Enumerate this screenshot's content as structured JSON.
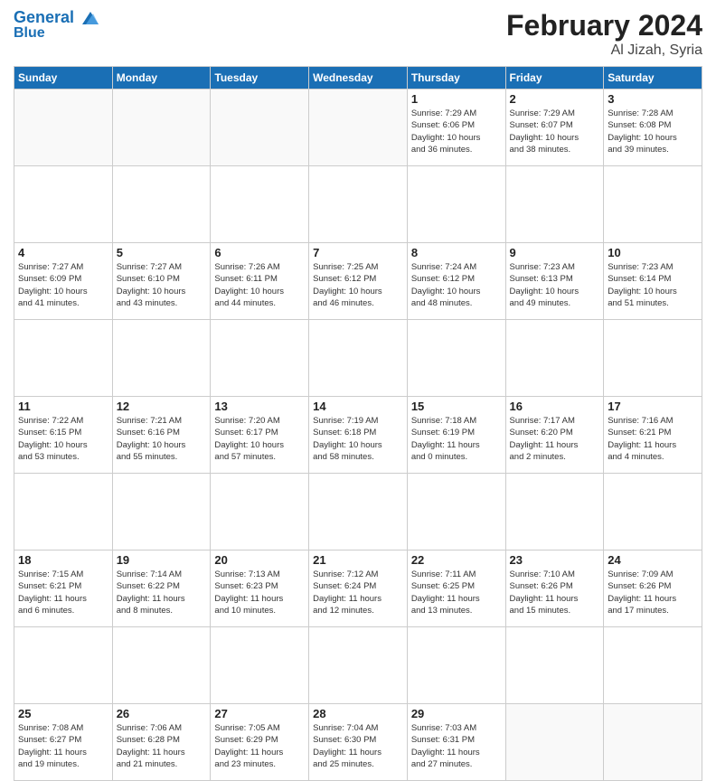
{
  "header": {
    "logo_line1": "General",
    "logo_line2": "Blue",
    "main_title": "February 2024",
    "sub_title": "Al Jizah, Syria"
  },
  "weekdays": [
    "Sunday",
    "Monday",
    "Tuesday",
    "Wednesday",
    "Thursday",
    "Friday",
    "Saturday"
  ],
  "weeks": [
    [
      {
        "day": "",
        "detail": ""
      },
      {
        "day": "",
        "detail": ""
      },
      {
        "day": "",
        "detail": ""
      },
      {
        "day": "",
        "detail": ""
      },
      {
        "day": "1",
        "detail": "Sunrise: 7:29 AM\nSunset: 6:06 PM\nDaylight: 10 hours\nand 36 minutes."
      },
      {
        "day": "2",
        "detail": "Sunrise: 7:29 AM\nSunset: 6:07 PM\nDaylight: 10 hours\nand 38 minutes."
      },
      {
        "day": "3",
        "detail": "Sunrise: 7:28 AM\nSunset: 6:08 PM\nDaylight: 10 hours\nand 39 minutes."
      }
    ],
    [
      {
        "day": "4",
        "detail": "Sunrise: 7:27 AM\nSunset: 6:09 PM\nDaylight: 10 hours\nand 41 minutes."
      },
      {
        "day": "5",
        "detail": "Sunrise: 7:27 AM\nSunset: 6:10 PM\nDaylight: 10 hours\nand 43 minutes."
      },
      {
        "day": "6",
        "detail": "Sunrise: 7:26 AM\nSunset: 6:11 PM\nDaylight: 10 hours\nand 44 minutes."
      },
      {
        "day": "7",
        "detail": "Sunrise: 7:25 AM\nSunset: 6:12 PM\nDaylight: 10 hours\nand 46 minutes."
      },
      {
        "day": "8",
        "detail": "Sunrise: 7:24 AM\nSunset: 6:12 PM\nDaylight: 10 hours\nand 48 minutes."
      },
      {
        "day": "9",
        "detail": "Sunrise: 7:23 AM\nSunset: 6:13 PM\nDaylight: 10 hours\nand 49 minutes."
      },
      {
        "day": "10",
        "detail": "Sunrise: 7:23 AM\nSunset: 6:14 PM\nDaylight: 10 hours\nand 51 minutes."
      }
    ],
    [
      {
        "day": "11",
        "detail": "Sunrise: 7:22 AM\nSunset: 6:15 PM\nDaylight: 10 hours\nand 53 minutes."
      },
      {
        "day": "12",
        "detail": "Sunrise: 7:21 AM\nSunset: 6:16 PM\nDaylight: 10 hours\nand 55 minutes."
      },
      {
        "day": "13",
        "detail": "Sunrise: 7:20 AM\nSunset: 6:17 PM\nDaylight: 10 hours\nand 57 minutes."
      },
      {
        "day": "14",
        "detail": "Sunrise: 7:19 AM\nSunset: 6:18 PM\nDaylight: 10 hours\nand 58 minutes."
      },
      {
        "day": "15",
        "detail": "Sunrise: 7:18 AM\nSunset: 6:19 PM\nDaylight: 11 hours\nand 0 minutes."
      },
      {
        "day": "16",
        "detail": "Sunrise: 7:17 AM\nSunset: 6:20 PM\nDaylight: 11 hours\nand 2 minutes."
      },
      {
        "day": "17",
        "detail": "Sunrise: 7:16 AM\nSunset: 6:21 PM\nDaylight: 11 hours\nand 4 minutes."
      }
    ],
    [
      {
        "day": "18",
        "detail": "Sunrise: 7:15 AM\nSunset: 6:21 PM\nDaylight: 11 hours\nand 6 minutes."
      },
      {
        "day": "19",
        "detail": "Sunrise: 7:14 AM\nSunset: 6:22 PM\nDaylight: 11 hours\nand 8 minutes."
      },
      {
        "day": "20",
        "detail": "Sunrise: 7:13 AM\nSunset: 6:23 PM\nDaylight: 11 hours\nand 10 minutes."
      },
      {
        "day": "21",
        "detail": "Sunrise: 7:12 AM\nSunset: 6:24 PM\nDaylight: 11 hours\nand 12 minutes."
      },
      {
        "day": "22",
        "detail": "Sunrise: 7:11 AM\nSunset: 6:25 PM\nDaylight: 11 hours\nand 13 minutes."
      },
      {
        "day": "23",
        "detail": "Sunrise: 7:10 AM\nSunset: 6:26 PM\nDaylight: 11 hours\nand 15 minutes."
      },
      {
        "day": "24",
        "detail": "Sunrise: 7:09 AM\nSunset: 6:26 PM\nDaylight: 11 hours\nand 17 minutes."
      }
    ],
    [
      {
        "day": "25",
        "detail": "Sunrise: 7:08 AM\nSunset: 6:27 PM\nDaylight: 11 hours\nand 19 minutes."
      },
      {
        "day": "26",
        "detail": "Sunrise: 7:06 AM\nSunset: 6:28 PM\nDaylight: 11 hours\nand 21 minutes."
      },
      {
        "day": "27",
        "detail": "Sunrise: 7:05 AM\nSunset: 6:29 PM\nDaylight: 11 hours\nand 23 minutes."
      },
      {
        "day": "28",
        "detail": "Sunrise: 7:04 AM\nSunset: 6:30 PM\nDaylight: 11 hours\nand 25 minutes."
      },
      {
        "day": "29",
        "detail": "Sunrise: 7:03 AM\nSunset: 6:31 PM\nDaylight: 11 hours\nand 27 minutes."
      },
      {
        "day": "",
        "detail": ""
      },
      {
        "day": "",
        "detail": ""
      }
    ]
  ]
}
